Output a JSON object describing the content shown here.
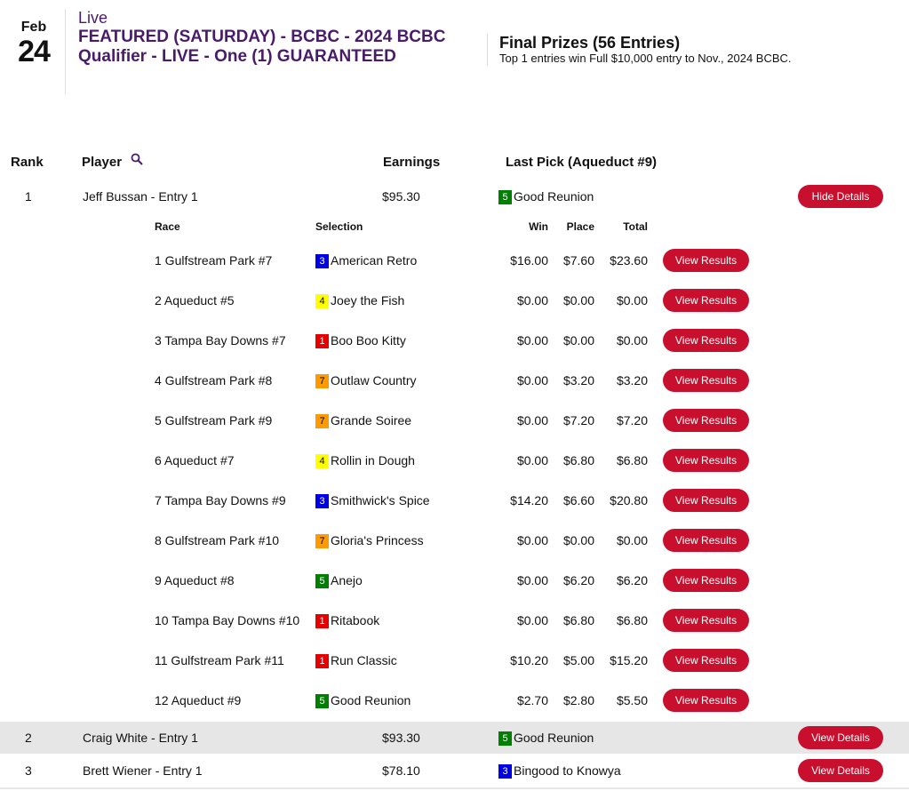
{
  "header": {
    "date_month": "Feb",
    "date_day": "24",
    "status": "Live",
    "event_title": "FEATURED (SATURDAY) - BCBC - 2024 BCBC Qualifier - LIVE - One (1) GUARANTEED",
    "prizes_title": "Final Prizes (56 Entries)",
    "prizes_desc": "Top 1 entries win Full $10,000 entry to Nov., 2024 BCBC."
  },
  "table": {
    "col_rank": "Rank",
    "col_player": "Player",
    "col_earnings": "Earnings",
    "col_last_pick": "Last Pick (Aqueduct #9)"
  },
  "entries": [
    {
      "rank": "1",
      "player": "Jeff Bussan - Entry 1",
      "earnings": "$95.30",
      "pick_num": "5",
      "pick_name": "Good Reunion",
      "button": "Hide Details"
    },
    {
      "rank": "2",
      "player": "Craig White - Entry 1",
      "earnings": "$93.30",
      "pick_num": "5",
      "pick_name": "Good Reunion",
      "button": "View Details"
    },
    {
      "rank": "3",
      "player": "Brett Wiener - Entry 1",
      "earnings": "$78.10",
      "pick_num": "3",
      "pick_name": "Bingood to Knowya",
      "button": "View Details"
    }
  ],
  "details": {
    "col_race": "Race",
    "col_selection": "Selection",
    "col_win": "Win",
    "col_place": "Place",
    "col_total": "Total",
    "button_label": "View Results",
    "rows": [
      {
        "race": "1 Gulfstream Park #7",
        "num": "3",
        "horse": "American Retro",
        "win": "$16.00",
        "place": "$7.60",
        "total": "$23.60"
      },
      {
        "race": "2 Aqueduct #5",
        "num": "4",
        "horse": "Joey the Fish",
        "win": "$0.00",
        "place": "$0.00",
        "total": "$0.00"
      },
      {
        "race": "3 Tampa Bay Downs #7",
        "num": "1",
        "horse": "Boo Boo Kitty",
        "win": "$0.00",
        "place": "$0.00",
        "total": "$0.00"
      },
      {
        "race": "4 Gulfstream Park #8",
        "num": "7",
        "horse": "Outlaw Country",
        "win": "$0.00",
        "place": "$3.20",
        "total": "$3.20"
      },
      {
        "race": "5 Gulfstream Park #9",
        "num": "7",
        "horse": "Grande Soiree",
        "win": "$0.00",
        "place": "$7.20",
        "total": "$7.20"
      },
      {
        "race": "6 Aqueduct #7",
        "num": "4",
        "horse": "Rollin in Dough",
        "win": "$0.00",
        "place": "$6.80",
        "total": "$6.80"
      },
      {
        "race": "7 Tampa Bay Downs #9",
        "num": "3",
        "horse": "Smithwick's Spice",
        "win": "$14.20",
        "place": "$6.60",
        "total": "$20.80"
      },
      {
        "race": "8 Gulfstream Park #10",
        "num": "7",
        "horse": "Gloria's Princess",
        "win": "$0.00",
        "place": "$0.00",
        "total": "$0.00"
      },
      {
        "race": "9 Aqueduct #8",
        "num": "5",
        "horse": "Anejo",
        "win": "$0.00",
        "place": "$6.20",
        "total": "$6.20"
      },
      {
        "race": "10 Tampa Bay Downs #10",
        "num": "1",
        "horse": "Ritabook",
        "win": "$0.00",
        "place": "$6.80",
        "total": "$6.80"
      },
      {
        "race": "11 Gulfstream Park #11",
        "num": "1",
        "horse": "Run Classic",
        "win": "$10.20",
        "place": "$5.00",
        "total": "$15.20"
      },
      {
        "race": "12 Aqueduct #9",
        "num": "5",
        "horse": "Good Reunion",
        "win": "$2.70",
        "place": "$2.80",
        "total": "$5.50"
      }
    ]
  },
  "colors": {
    "accent_red": "#c8102e",
    "title_purple": "#4a1a6b",
    "row_shade": "#e6e6e6"
  },
  "icons": {
    "player_search": "search-icon"
  }
}
